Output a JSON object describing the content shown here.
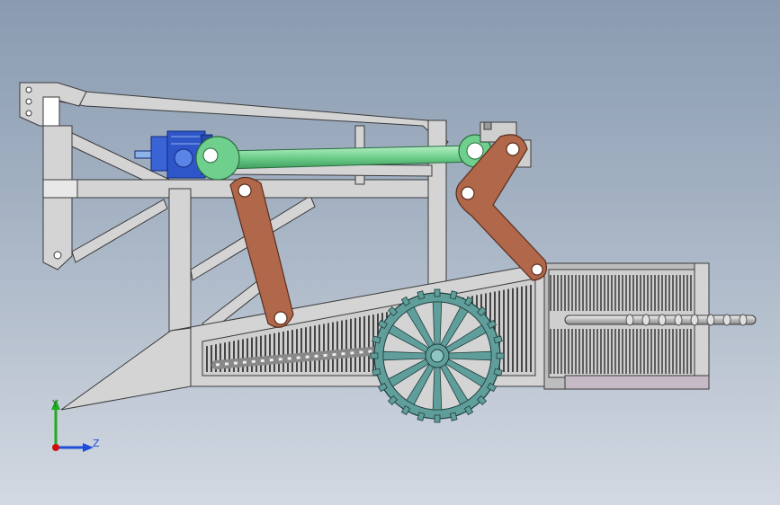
{
  "triad": {
    "y_label": "Y",
    "z_label": "Z",
    "y_color": "#22aa22",
    "z_color": "#1f4fd8",
    "origin_color": "#d01010"
  },
  "colors": {
    "frame": "#d4d4d4",
    "frame_stroke": "#3a3a3a",
    "link": "#b0674a",
    "rod": "#6fcf8c",
    "motor": "#2f56c8",
    "wheel": "#5f9e9a",
    "screen_bg": "#bdbdbd",
    "panel": "#c6bac6"
  }
}
